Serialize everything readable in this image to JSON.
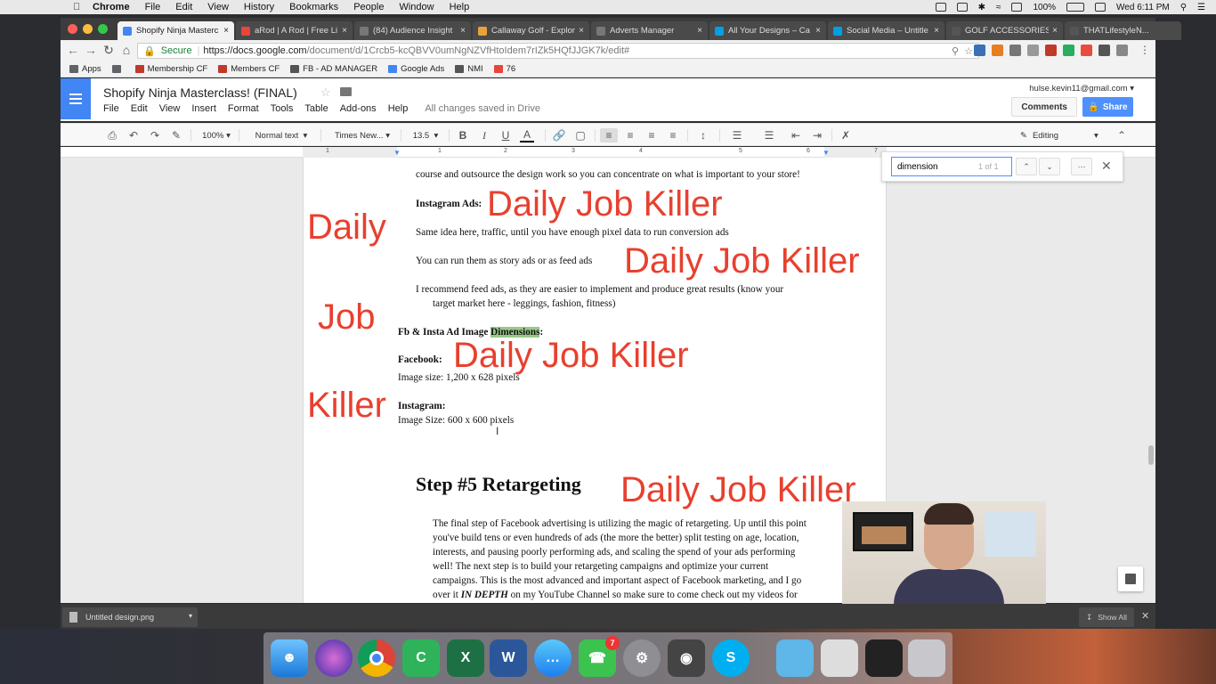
{
  "menubar": {
    "apple": "",
    "app": "Chrome",
    "items": [
      "File",
      "Edit",
      "View",
      "History",
      "Bookmarks",
      "People",
      "Window",
      "Help"
    ],
    "battery": "100%",
    "clock": "Wed 6:11 PM"
  },
  "tabs": [
    {
      "title": "Shopify Ninja Masterc",
      "color": "#4285f4",
      "active": true
    },
    {
      "title": "aRod | A Rod | Free Li",
      "color": "#e8453c",
      "active": false
    },
    {
      "title": "(84) Audience Insight",
      "color": "#777777",
      "active": false
    },
    {
      "title": "Callaway Golf - Explor",
      "color": "#e9a23b",
      "active": false
    },
    {
      "title": "Adverts Manager",
      "color": "#777777",
      "active": false
    },
    {
      "title": "All Your Designs – Ca",
      "color": "#00a0e3",
      "active": false
    },
    {
      "title": "Social Media – Untitle",
      "color": "#00a0e3",
      "active": false
    },
    {
      "title": "GOLF ACCESSORIES",
      "color": "#555555",
      "active": false
    },
    {
      "title": "THATLifestyleN...",
      "color": "#555555",
      "active": false
    }
  ],
  "address": {
    "secure_label": "Secure",
    "host": "https://docs.google.com",
    "path": "/document/d/1Crcb5-kcQBVV0umNgNZVfHtoIdem7rIZk5HQfJJGK7k/edit#"
  },
  "bookmarks": [
    {
      "label": "Apps",
      "color": "#5f6368"
    },
    {
      "label": "",
      "color": "#5f6368"
    },
    {
      "label": "Membership CF",
      "color": "#c0392b"
    },
    {
      "label": "Members CF",
      "color": "#c0392b"
    },
    {
      "label": "FB - AD MANAGER",
      "color": "#555555"
    },
    {
      "label": "Google Ads",
      "color": "#4285f4"
    },
    {
      "label": "NMI",
      "color": "#555555"
    },
    {
      "label": "76",
      "color": "#e8453c"
    }
  ],
  "docs": {
    "title": "Shopify Ninja Masterclass! (FINAL)",
    "menu": [
      "File",
      "Edit",
      "View",
      "Insert",
      "Format",
      "Tools",
      "Table",
      "Add-ons",
      "Help"
    ],
    "saved": "All changes saved in Drive",
    "account": "hulse.kevin11@gmail.com",
    "comments": "Comments",
    "share": "Share"
  },
  "toolbar": {
    "zoom": "100%",
    "style": "Normal text",
    "font": "Times New...",
    "size": "13.5",
    "mode": "Editing"
  },
  "ruler": [
    "1",
    "1",
    "2",
    "3",
    "4",
    "5",
    "6",
    "7"
  ],
  "find": {
    "query": "dimension",
    "count": "1 of 1"
  },
  "document": {
    "line_outsource": "course and outsource the design work so you can concentrate on what is important to your store!",
    "insta_heading": "Instagram Ads:",
    "insta_p1": "Same idea here, traffic, until you have enough pixel data to run conversion ads",
    "insta_p2": "You can run them as story ads or as feed ads",
    "insta_p3a": "I recommend feed ads, as they are easier to implement and produce great results (know your",
    "insta_p3b": "target market here - leggings, fashion, fitness)",
    "dims_pre": "Fb & Insta Ad Image ",
    "dims_hl": "Dimensions",
    "dims_post": ":",
    "fb_heading": "Facebook:",
    "fb_size": "Image size: 1,200 x 628 pixels",
    "ig_heading": "Instagram:",
    "ig_size": "Image Size: 600 x 600 pixels",
    "step5": "Step #5 Retargeting",
    "step5_lines": [
      "The final step of Facebook advertising is utilizing the magic of retargeting. Up until this point",
      "you've build tens or even hundreds of ads (the more the better) split testing on age, location,",
      "interests, and pausing poorly performing ads, and scaling the spend of your ads performing",
      "well! The next step is to build your retargeting campaigns and optimize your current",
      "campaigns. This is the most advanced and important aspect of Facebook marketing, and I go"
    ],
    "step5_last_pre": "over it ",
    "step5_last_em": "IN DEPTH",
    "step5_last_post": " on my YouTube Channel so make sure to come check out my videos for"
  },
  "overlays": {
    "phrase": "Daily Job Killer",
    "w1": "Daily",
    "w2": "Job",
    "w3": "Killer",
    "color": "#e8402f"
  },
  "downloads": {
    "file": "Untitled design.png",
    "show_all": "Show All"
  },
  "dock": {
    "facetime_badge": "7"
  }
}
